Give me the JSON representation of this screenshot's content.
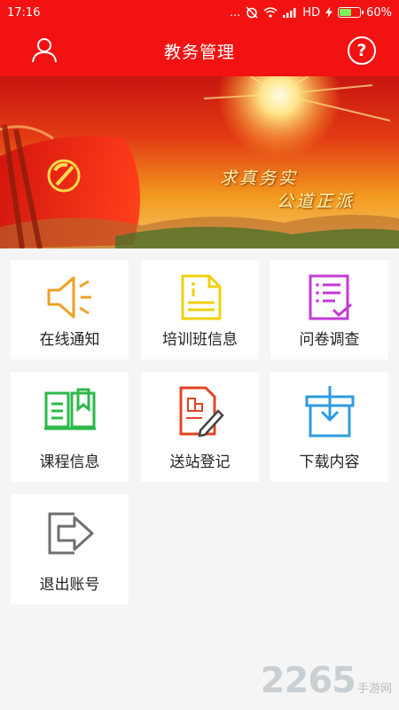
{
  "status_bar": {
    "time": "17:16",
    "dots": "...",
    "network": "HD",
    "battery": "60%",
    "battery_level": 0.6
  },
  "header": {
    "title": "教务管理",
    "help_glyph": "?",
    "left_icon": "user-icon",
    "right_icon": "help-icon"
  },
  "banner": {
    "slogan_line1": "求真务实",
    "slogan_line2": "公道正派"
  },
  "menu": {
    "items": [
      {
        "label": "在线通知",
        "icon": "megaphone-icon",
        "color": "#f0a020"
      },
      {
        "label": "培训班信息",
        "icon": "document-info-icon",
        "color": "#f0d010"
      },
      {
        "label": "问卷调查",
        "icon": "survey-checklist-icon",
        "color": "#c33ad6"
      },
      {
        "label": "课程信息",
        "icon": "open-book-icon",
        "color": "#2db84a"
      },
      {
        "label": "送站登记",
        "icon": "registration-form-icon",
        "color": "#e04424"
      },
      {
        "label": "下载内容",
        "icon": "download-box-icon",
        "color": "#2d9ce0"
      },
      {
        "label": "退出账号",
        "icon": "logout-icon",
        "color": "#6f6f6f"
      }
    ]
  },
  "watermark": {
    "number": "2265",
    "suffix": "手游网"
  }
}
